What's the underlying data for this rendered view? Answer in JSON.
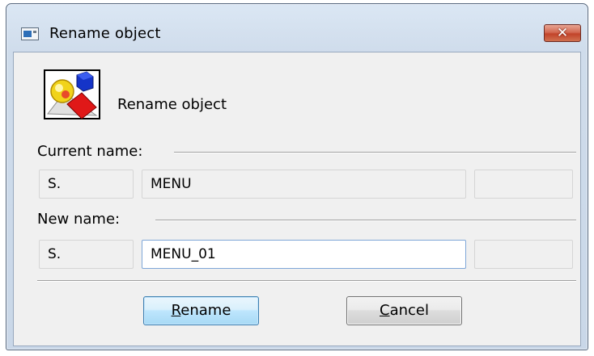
{
  "window": {
    "title": "Rename object",
    "close_symbol": "✕"
  },
  "header": {
    "label": "Rename object",
    "icon": "objects-icon"
  },
  "current": {
    "section_label": "Current name:",
    "prefix": "S.",
    "name": "MENU",
    "suffix": ""
  },
  "new": {
    "section_label": "New name:",
    "prefix": "S.",
    "name": "MENU_01",
    "suffix": ""
  },
  "buttons": {
    "rename_first": "R",
    "rename_rest": "ename",
    "cancel_first": "C",
    "cancel_rest": "ancel"
  }
}
